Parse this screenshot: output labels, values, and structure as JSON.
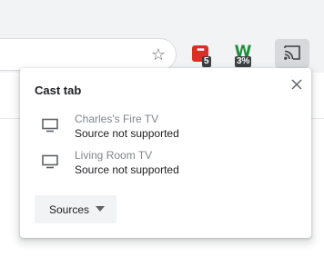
{
  "toolbar": {
    "star_icon": "star-outline-icon",
    "extensions": [
      {
        "icon": "red-dots-extension-icon",
        "badge": "5",
        "glyph": "•••"
      },
      {
        "icon": "green-w-extension-icon",
        "badge": "3%",
        "glyph": "W"
      }
    ],
    "cast_icon": "cast-icon"
  },
  "dialog": {
    "title": "Cast tab",
    "sinks": [
      {
        "name": "Charles's Fire TV",
        "status": "Source not supported",
        "icon": "tv-icon"
      },
      {
        "name": "Living Room TV",
        "status": "Source not supported",
        "icon": "tv-icon"
      }
    ],
    "sources_label": "Sources"
  },
  "colors": {
    "toolbar_bg": "#f1f3f4",
    "text_primary": "#202124",
    "text_secondary": "#80868b",
    "ext_red": "#d93025",
    "ext_green": "#1e8e3e"
  }
}
